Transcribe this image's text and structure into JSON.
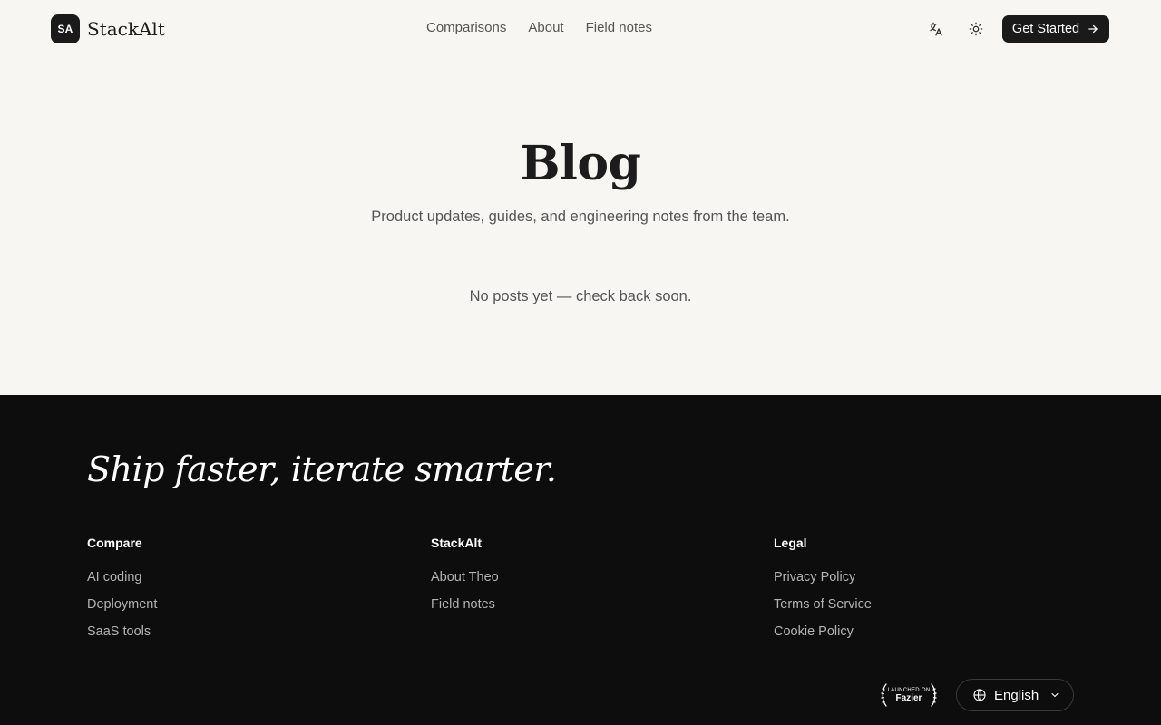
{
  "header": {
    "logo_initials": "SA",
    "logo_name": "StackAlt",
    "nav": [
      "Comparisons",
      "About",
      "Field notes"
    ],
    "cta_label": "Get Started"
  },
  "hero": {
    "title": "Blog",
    "subtitle": "Product updates, guides, and engineering notes from the team.",
    "empty_state": "No posts yet — check back soon."
  },
  "footer": {
    "tagline": "Ship faster, iterate smarter.",
    "columns": [
      {
        "heading": "Compare",
        "links": [
          "AI coding",
          "Deployment",
          "SaaS tools"
        ]
      },
      {
        "heading": "StackAlt",
        "links": [
          "About Theo",
          "Field notes"
        ]
      },
      {
        "heading": "Legal",
        "links": [
          "Privacy Policy",
          "Terms of Service",
          "Cookie Policy"
        ]
      }
    ],
    "badge": {
      "small": "LAUNCHED ON",
      "big": "Fazier"
    },
    "language": "English"
  },
  "icons": {
    "translate": "translate-icon",
    "theme": "sun-icon",
    "cta_arrow": "arrow-right-icon",
    "language": "globe-icon",
    "language_chevron": "chevron-down-icon"
  },
  "colors": {
    "page_bg": "#f7f6f2",
    "footer_bg": "#0d0d0d",
    "primary": "#1a1a1a"
  }
}
